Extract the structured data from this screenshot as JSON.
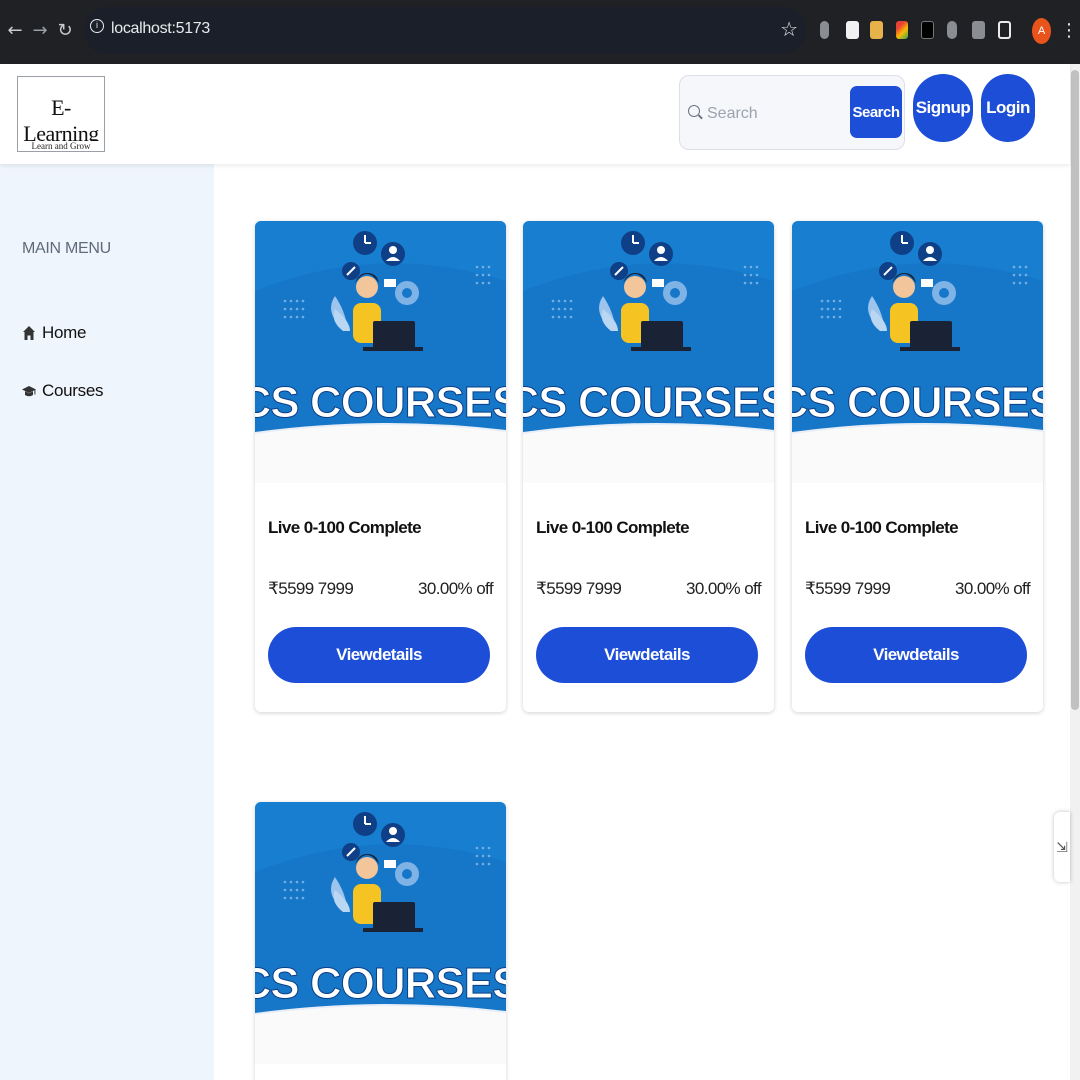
{
  "browser": {
    "url": "localhost:5173",
    "avatar_letter": "A",
    "colors": {
      "chrome": "#202124",
      "omnibox": "#1b1f2a",
      "avatar": "#e8541b"
    }
  },
  "header": {
    "logo": {
      "title": "E-Learning",
      "tagline": "Learn and Grow"
    },
    "search": {
      "placeholder": "Search",
      "button_label": "Search"
    },
    "signup_label": "Signup",
    "login_label": "Login"
  },
  "sidebar": {
    "title": "MAIN MENU",
    "items": [
      {
        "label": "Home",
        "icon": "home-icon"
      },
      {
        "label": "Courses",
        "icon": "graduation-cap-icon"
      }
    ]
  },
  "courses": [
    {
      "image_text": "CS COURSES",
      "title": "Live 0-100 Complete",
      "price": "₹5599 7999",
      "discount": "30.00% off",
      "button_label": "Viewdetails"
    },
    {
      "image_text": "CS COURSES",
      "title": "Live 0-100 Complete",
      "price": "₹5599 7999",
      "discount": "30.00% off",
      "button_label": "Viewdetails"
    },
    {
      "image_text": "CS COURSES",
      "title": "Live 0-100 Complete",
      "price": "₹5599 7999",
      "discount": "30.00% off",
      "button_label": "Viewdetails"
    },
    {
      "image_text": "CS COURSES"
    }
  ],
  "theme": {
    "primary": "#1d4ed8",
    "sidebar_bg": "#eff5fc",
    "banner_blue": "#1677c9"
  }
}
